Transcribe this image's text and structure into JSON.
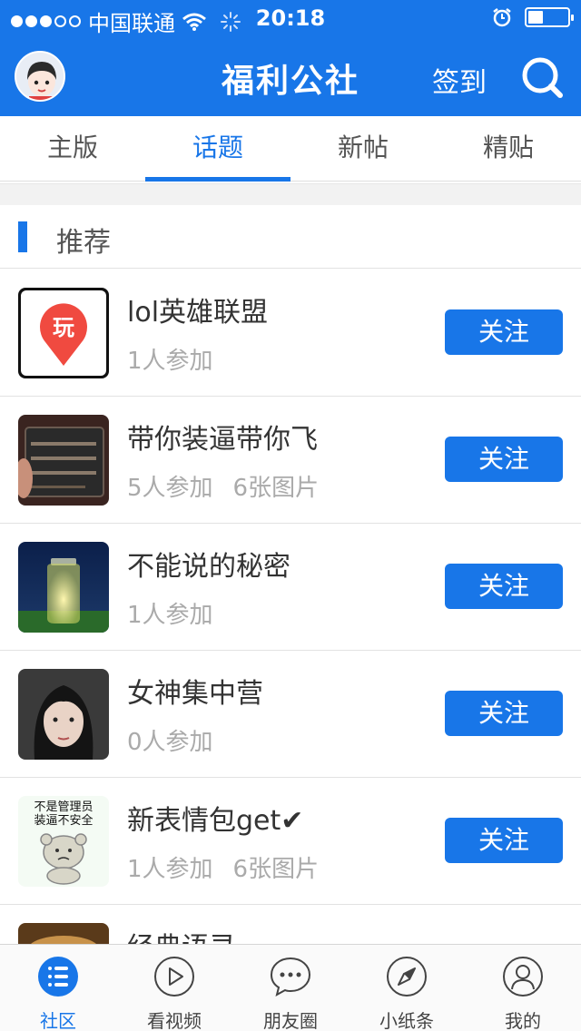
{
  "status_bar": {
    "carrier": "中国联通",
    "time": "20:18"
  },
  "header": {
    "title": "福利公社",
    "checkin_label": "签到"
  },
  "tabs": [
    {
      "label": "主版",
      "active": false
    },
    {
      "label": "话题",
      "active": true
    },
    {
      "label": "新帖",
      "active": false
    },
    {
      "label": "精贴",
      "active": false
    }
  ],
  "section": {
    "label": "推荐"
  },
  "topics": [
    {
      "name": "lol英雄联盟",
      "participants": "1人参加",
      "images": "",
      "follow_label": "关注",
      "thumb_text": "玩"
    },
    {
      "name": "带你装逼带你飞",
      "participants": "5人参加",
      "images": "6张图片",
      "follow_label": "关注"
    },
    {
      "name": "不能说的秘密",
      "participants": "1人参加",
      "images": "",
      "follow_label": "关注"
    },
    {
      "name": "女神集中营",
      "participants": "0人参加",
      "images": "",
      "follow_label": "关注"
    },
    {
      "name": "新表情包get✔",
      "participants": "1人参加",
      "images": "6张图片",
      "follow_label": "关注",
      "thumb_text_1": "不是管理员",
      "thumb_text_2": "装逼不安全"
    },
    {
      "name": "经典语录",
      "participants": "",
      "images": "",
      "follow_label": ""
    }
  ],
  "bottom_nav": [
    {
      "label": "社区",
      "icon": "list-icon",
      "active": true
    },
    {
      "label": "看视频",
      "icon": "play-icon",
      "active": false
    },
    {
      "label": "朋友圈",
      "icon": "chat-bubble-icon",
      "active": false
    },
    {
      "label": "小纸条",
      "icon": "compass-icon",
      "active": false
    },
    {
      "label": "我的",
      "icon": "user-icon",
      "active": false
    }
  ],
  "colors": {
    "accent": "#1876e8",
    "muted_text": "#aaaaaa"
  }
}
